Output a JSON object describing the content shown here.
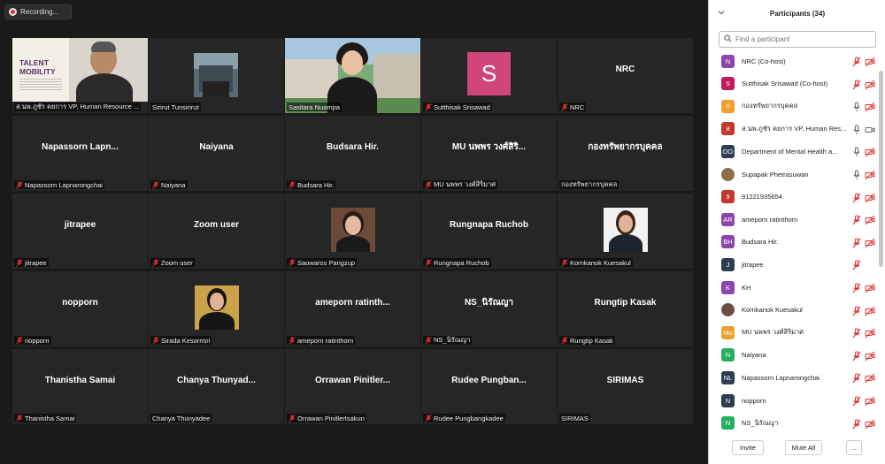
{
  "recording": {
    "label": "Recording..."
  },
  "tiles": [
    {
      "id": "t1",
      "display": "",
      "label": "ส.นพ.ภูชัร คยการ VP, Human Resource ...",
      "muted": false,
      "photo": "talent"
    },
    {
      "id": "t2",
      "display": "",
      "label": "Sirirut Tunsirirut",
      "muted": false,
      "photo": "sirirut"
    },
    {
      "id": "t3",
      "display": "",
      "label": "Sasitara Nuampa",
      "muted": false,
      "photo": "sasitara"
    },
    {
      "id": "t4",
      "display": "S",
      "label": "Sutthisak Srisawad",
      "muted": true
    },
    {
      "id": "t5",
      "display": "NRC",
      "label": "NRC",
      "muted": true
    },
    {
      "id": "t6",
      "display": "Napassorn  Lapn...",
      "label": "Napassorn Lapnarongchai",
      "muted": true
    },
    {
      "id": "t7",
      "display": "Naiyana",
      "label": "Naiyana",
      "muted": true
    },
    {
      "id": "t8",
      "display": "Budsara Hir.",
      "label": "Budsara Hir.",
      "muted": true
    },
    {
      "id": "t9",
      "display": "MU นพพร วงศ์สิริ...",
      "label": "MU นพพร วงศ์สิริมาศ",
      "muted": true
    },
    {
      "id": "t10",
      "display": "กองทรัพยากรบุคคล",
      "label": "กองทรัพยากรบุคคล",
      "muted": false
    },
    {
      "id": "t11",
      "display": "jitrapee",
      "label": "jitrapee",
      "muted": true
    },
    {
      "id": "t12",
      "display": "Zoom user",
      "label": "Zoom user",
      "muted": true
    },
    {
      "id": "t13",
      "display": "",
      "label": "Saowaros Pangzup",
      "muted": true,
      "photo": "saowaros"
    },
    {
      "id": "t14",
      "display": "Rungnapa Ruchob",
      "label": "Rungnapa Ruchob",
      "muted": true
    },
    {
      "id": "t15",
      "display": "",
      "label": "Kornkanok Kuesakul",
      "muted": true,
      "photo": "kornkanok"
    },
    {
      "id": "t16",
      "display": "nopporn",
      "label": "nopporn",
      "muted": true
    },
    {
      "id": "t17",
      "display": "",
      "label": "Sirada Kesornsri",
      "muted": true,
      "photo": "sirada"
    },
    {
      "id": "t18",
      "display": "ameporn  ratinth...",
      "label": "ameporn ratinthorn",
      "muted": true
    },
    {
      "id": "t19",
      "display": "NS_นิรัณญา",
      "label": "NS_นิรัณญา",
      "muted": true
    },
    {
      "id": "t20",
      "display": "Rungtip Kasak",
      "label": "Rungtip Kasak",
      "muted": true
    },
    {
      "id": "t21",
      "display": "Thanistha Samai",
      "label": "Thanistha Samai",
      "muted": true
    },
    {
      "id": "t22",
      "display": "Chanya  Thunyad...",
      "label": "Chanya Thunyadee",
      "muted": false
    },
    {
      "id": "t23",
      "display": "Orrawan  Pinitler...",
      "label": "Orrawan Pinitlertsakun",
      "muted": true
    },
    {
      "id": "t24",
      "display": "Rudee  Pungban...",
      "label": "Rudee Pungbangkadee",
      "muted": true
    },
    {
      "id": "t25",
      "display": "SIRIMAS",
      "label": "SIRIMAS",
      "muted": false
    }
  ],
  "talent_text": {
    "line1": "TALENT",
    "line2": "MOBILITY"
  },
  "panel": {
    "title": "Participants (34)",
    "search_placeholder": "Find a participant",
    "invite_label": "Invite",
    "mute_all_label": "Mute All",
    "more_label": "..."
  },
  "participants": [
    {
      "initial": "N",
      "color": "#8e44ad",
      "name": "NRC (Co-host)",
      "mic": "muted",
      "video": "off"
    },
    {
      "initial": "S",
      "color": "#c2185b",
      "name": "Sutthisak Srisawad (Co-host)",
      "mic": "muted",
      "video": "off"
    },
    {
      "initial": "ก",
      "color": "#f0a030",
      "name": "กองทรัพยากรบุคคล",
      "mic": "on",
      "video": "off"
    },
    {
      "initial": "ส",
      "color": "#c0392b",
      "name": "ส.นพ.ภูชัร คยการ VP, Human Res...",
      "mic": "on",
      "video": "on"
    },
    {
      "initial": "DO",
      "color": "#2c3e50",
      "name": "Department of Mental Health a...",
      "mic": "on",
      "video": "off"
    },
    {
      "initial": "",
      "color": "#8d6e4a",
      "name": "Supapak Phetrasuwan",
      "mic": "on",
      "video": "off"
    },
    {
      "initial": "9",
      "color": "#c0392b",
      "name": "91221935654",
      "mic": "muted",
      "video": "off"
    },
    {
      "initial": "AR",
      "color": "#8e44ad",
      "name": "ameporn ratinthorn",
      "mic": "muted",
      "video": "off"
    },
    {
      "initial": "BH",
      "color": "#8e44ad",
      "name": "Budsara Hir.",
      "mic": "muted",
      "video": "off"
    },
    {
      "initial": "J",
      "color": "#2c3e50",
      "name": "jitrapee",
      "mic": "muted",
      "video": "none"
    },
    {
      "initial": "K",
      "color": "#8e44ad",
      "name": "KH",
      "mic": "muted",
      "video": "off"
    },
    {
      "initial": "",
      "color": "#6d4c41",
      "name": "Kornkanok Kuesakul",
      "mic": "muted",
      "video": "off"
    },
    {
      "initial": "Mu",
      "color": "#f0a030",
      "name": "MU นพพร วงศ์สิริมาศ",
      "mic": "muted",
      "video": "off"
    },
    {
      "initial": "N",
      "color": "#27ae60",
      "name": "Naiyana",
      "mic": "muted",
      "video": "off"
    },
    {
      "initial": "NL",
      "color": "#2c3e50",
      "name": "Napassorn Lapnarongchai",
      "mic": "muted",
      "video": "off"
    },
    {
      "initial": "N",
      "color": "#2c3e50",
      "name": "nopporn",
      "mic": "muted",
      "video": "off"
    },
    {
      "initial": "N",
      "color": "#27ae60",
      "name": "NS_นิรัณญา",
      "mic": "muted",
      "video": "off"
    }
  ]
}
